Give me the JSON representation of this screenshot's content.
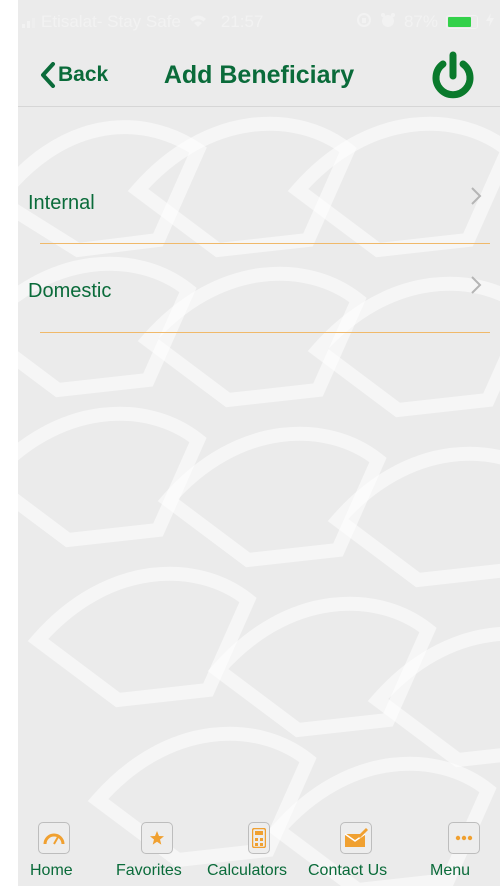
{
  "status_bar": {
    "carrier": "Etisalat- Stay Safe",
    "time": "21:57",
    "battery": "87%",
    "battery_level": 0.87
  },
  "header": {
    "back_label": "Back",
    "title": "Add Beneficiary"
  },
  "list": {
    "items": [
      {
        "label": "Internal"
      },
      {
        "label": "Domestic"
      }
    ]
  },
  "tab_bar": {
    "items": [
      {
        "label": "Home",
        "icon": "speedometer-icon"
      },
      {
        "label": "Favorites",
        "icon": "star-icon"
      },
      {
        "label": "Calculators",
        "icon": "calculator-icon"
      },
      {
        "label": "Contact Us",
        "icon": "envelope-icon"
      },
      {
        "label": "Menu",
        "icon": "more-dots-icon"
      }
    ]
  },
  "colors": {
    "brand_green": "#0a6b3a",
    "accent_orange": "#f0a030",
    "separator": "#f0b96a",
    "background": "#ebebeb"
  }
}
